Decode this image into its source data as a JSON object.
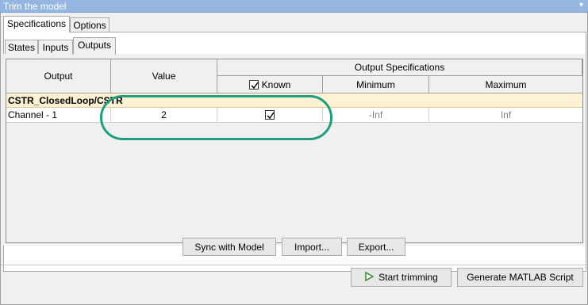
{
  "window": {
    "title": "Trim the model"
  },
  "tabs": {
    "specifications": "Specifications",
    "options": "Options"
  },
  "subtabs": {
    "states": "States",
    "inputs": "Inputs",
    "outputs": "Outputs"
  },
  "table": {
    "headers": {
      "output": "Output",
      "value": "Value",
      "group": "Output Specifications",
      "known": "Known",
      "minimum": "Minimum",
      "maximum": "Maximum"
    },
    "group_label": "CSTR_ClosedLoop/CSTR",
    "rows": [
      {
        "output": "Channel - 1",
        "value": "2",
        "known": true,
        "minimum": "-Inf",
        "maximum": "Inf"
      }
    ]
  },
  "buttons": {
    "sync": "Sync with Model",
    "import": "Import...",
    "export": "Export...",
    "start_trimming": "Start trimming",
    "generate_script": "Generate MATLAB Script"
  },
  "colors": {
    "highlight": "#1f9e7f",
    "group_row": "#fdf3d4",
    "play_icon": "#2e8b2e"
  }
}
